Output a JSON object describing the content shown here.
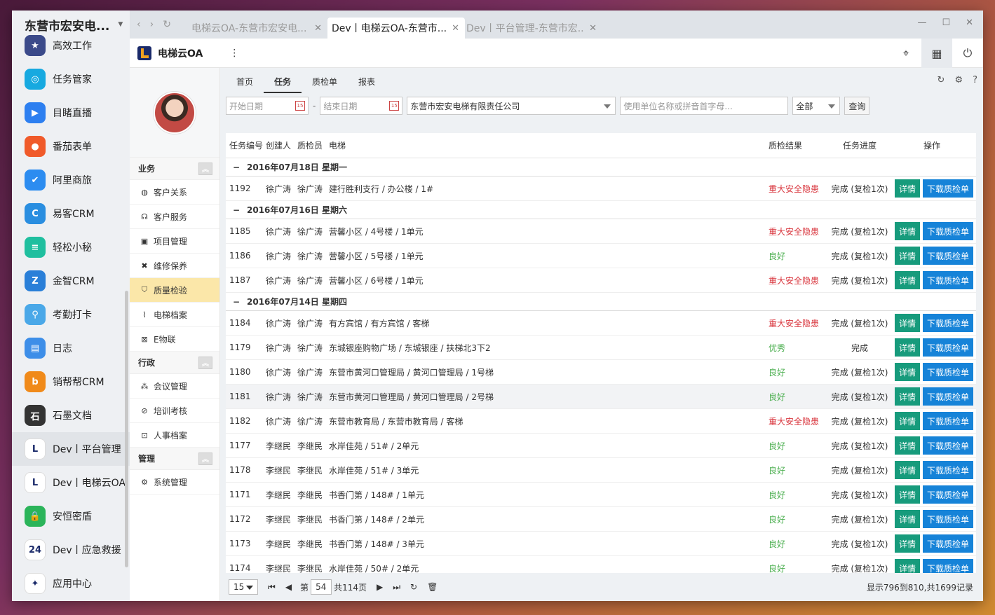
{
  "apps": {
    "title": "东营市宏安电...",
    "items": [
      {
        "label": "高效工作",
        "color": "#3b4a8a",
        "glyph": "★"
      },
      {
        "label": "任务管家",
        "color": "#17a9e0",
        "glyph": "◎"
      },
      {
        "label": "目睹直播",
        "color": "#2d7ff0",
        "glyph": "▶"
      },
      {
        "label": "番茄表单",
        "color": "#f05a2a",
        "glyph": "●"
      },
      {
        "label": "阿里商旅",
        "color": "#2c8cf0",
        "glyph": "✔"
      },
      {
        "label": "易客CRM",
        "color": "#2a8ee0",
        "glyph": "C"
      },
      {
        "label": "轻松小秘",
        "color": "#1fbf9f",
        "glyph": "≡"
      },
      {
        "label": "金智CRM",
        "color": "#2a7fd8",
        "glyph": "Z"
      },
      {
        "label": "考勤打卡",
        "color": "#4aa8e8",
        "glyph": "⚲"
      },
      {
        "label": "日志",
        "color": "#3d8ee8",
        "glyph": "▤"
      },
      {
        "label": "销帮帮CRM",
        "color": "#f08a1a",
        "glyph": "b"
      },
      {
        "label": "石墨文档",
        "color": "#333333",
        "glyph": "石"
      },
      {
        "label": "Dev丨平台管理",
        "color": "#ffffff",
        "glyph": "L"
      },
      {
        "label": "Dev丨电梯云OA",
        "color": "#ffffff",
        "glyph": "L"
      },
      {
        "label": "安恒密盾",
        "color": "#2bb45a",
        "glyph": "🔒"
      },
      {
        "label": "Dev丨应急救援",
        "color": "#ffffff",
        "glyph": "24"
      },
      {
        "label": "应用中心",
        "color": "#ffffff",
        "glyph": "✦"
      }
    ]
  },
  "browser_tabs": [
    {
      "label": "电梯云OA-东营市宏安电..."
    },
    {
      "label": "Dev丨电梯云OA-东营市..."
    },
    {
      "label": "Dev丨平台管理-东营市宏..."
    }
  ],
  "app": {
    "name": "电梯云OA"
  },
  "menu": {
    "groups": [
      {
        "title": "业务",
        "items": [
          {
            "label": "客户关系",
            "icon": "crm-icon",
            "glyph": "◍"
          },
          {
            "label": "客户服务",
            "icon": "headset-icon",
            "glyph": "☊"
          },
          {
            "label": "项目管理",
            "icon": "project-icon",
            "glyph": "▣"
          },
          {
            "label": "维修保养",
            "icon": "tools-icon",
            "glyph": "✖"
          },
          {
            "label": "质量检验",
            "icon": "shield-icon",
            "glyph": "⛉"
          },
          {
            "label": "电梯档案",
            "icon": "archive-icon",
            "glyph": "⌇"
          },
          {
            "label": "E物联",
            "icon": "iot-icon",
            "glyph": "⊠"
          }
        ]
      },
      {
        "title": "行政",
        "items": [
          {
            "label": "会议管理",
            "icon": "meeting-icon",
            "glyph": "⁂"
          },
          {
            "label": "培训考核",
            "icon": "training-icon",
            "glyph": "⊘"
          },
          {
            "label": "人事档案",
            "icon": "personnel-icon",
            "glyph": "⊡"
          }
        ]
      },
      {
        "title": "管理",
        "items": [
          {
            "label": "系统管理",
            "icon": "settings-icon",
            "glyph": "⚙"
          }
        ]
      }
    ]
  },
  "subtabs": [
    "首页",
    "任务",
    "质检单",
    "报表"
  ],
  "filters": {
    "start_ph": "开始日期",
    "end_ph": "结束日期",
    "company": "东营市宏安电梯有限责任公司",
    "unit_ph": "使用单位名称或拼音首字母...",
    "scope": "全部",
    "query": "查询"
  },
  "table": {
    "headers": {
      "id": "任务编号",
      "creator": "创建人",
      "inspector": "质检员",
      "elevator": "电梯",
      "result": "质检结果",
      "progress": "任务进度",
      "ops": "操作"
    },
    "detail_label": "详情",
    "download_label": "下载质检单",
    "groups": [
      {
        "date": "2016年07月18日 星期一",
        "rows": [
          {
            "id": "1192",
            "creator": "徐广涛",
            "inspector": "徐广涛",
            "elevator": "建行胜利支行 / 办公楼 / 1#",
            "result": "重大安全隐患",
            "status": "bad",
            "progress": "完成 (复检1次)"
          }
        ]
      },
      {
        "date": "2016年07月16日 星期六",
        "rows": [
          {
            "id": "1185",
            "creator": "徐广涛",
            "inspector": "徐广涛",
            "elevator": "营馨小区 / 4号楼 / 1单元",
            "result": "重大安全隐患",
            "status": "bad",
            "progress": "完成 (复检1次)"
          },
          {
            "id": "1186",
            "creator": "徐广涛",
            "inspector": "徐广涛",
            "elevator": "营馨小区 / 5号楼 / 1单元",
            "result": "良好",
            "status": "ok",
            "progress": "完成 (复检1次)"
          },
          {
            "id": "1187",
            "creator": "徐广涛",
            "inspector": "徐广涛",
            "elevator": "营馨小区 / 6号楼 / 1单元",
            "result": "重大安全隐患",
            "status": "bad",
            "progress": "完成 (复检1次)"
          }
        ]
      },
      {
        "date": "2016年07月14日 星期四",
        "rows": [
          {
            "id": "1184",
            "creator": "徐广涛",
            "inspector": "徐广涛",
            "elevator": "有方宾馆 / 有方宾馆 / 客梯",
            "result": "重大安全隐患",
            "status": "bad",
            "progress": "完成 (复检1次)"
          },
          {
            "id": "1179",
            "creator": "徐广涛",
            "inspector": "徐广涛",
            "elevator": "东城银座购物广场 / 东城银座 / 扶梯北3下2",
            "result": "优秀",
            "status": "ok",
            "progress": "完成"
          },
          {
            "id": "1180",
            "creator": "徐广涛",
            "inspector": "徐广涛",
            "elevator": "东营市黄河口管理局 / 黄河口管理局 / 1号梯",
            "result": "良好",
            "status": "ok",
            "progress": "完成 (复检1次)"
          },
          {
            "id": "1181",
            "creator": "徐广涛",
            "inspector": "徐广涛",
            "elevator": "东营市黄河口管理局 / 黄河口管理局 / 2号梯",
            "result": "良好",
            "status": "ok",
            "progress": "完成 (复检1次)",
            "hl": true
          },
          {
            "id": "1182",
            "creator": "徐广涛",
            "inspector": "徐广涛",
            "elevator": "东营市教育局 / 东营市教育局 / 客梯",
            "result": "重大安全隐患",
            "status": "bad",
            "progress": "完成 (复检1次)"
          },
          {
            "id": "1177",
            "creator": "李继民",
            "inspector": "李继民",
            "elevator": "水岸佳苑 / 51# / 2单元",
            "result": "良好",
            "status": "ok",
            "progress": "完成 (复检1次)"
          },
          {
            "id": "1178",
            "creator": "李继民",
            "inspector": "李继民",
            "elevator": "水岸佳苑 / 51# / 3单元",
            "result": "良好",
            "status": "ok",
            "progress": "完成 (复检1次)"
          },
          {
            "id": "1171",
            "creator": "李继民",
            "inspector": "李继民",
            "elevator": "书香门第 / 148# / 1单元",
            "result": "良好",
            "status": "ok",
            "progress": "完成 (复检1次)"
          },
          {
            "id": "1172",
            "creator": "李继民",
            "inspector": "李继民",
            "elevator": "书香门第 / 148# / 2单元",
            "result": "良好",
            "status": "ok",
            "progress": "完成 (复检1次)"
          },
          {
            "id": "1173",
            "creator": "李继民",
            "inspector": "李继民",
            "elevator": "书香门第 / 148# / 3单元",
            "result": "良好",
            "status": "ok",
            "progress": "完成 (复检1次)"
          },
          {
            "id": "1174",
            "creator": "李继民",
            "inspector": "李继民",
            "elevator": "水岸佳苑 / 50# / 2单元",
            "result": "良好",
            "status": "ok",
            "progress": "完成 (复检1次)"
          }
        ]
      }
    ]
  },
  "pager": {
    "page_size": "15",
    "page_prefix": "第",
    "page": "54",
    "total_pages": "共114页",
    "info": "显示796到810,共1699记录"
  },
  "colors": {
    "ok": "#4caf50",
    "bad": "#d9363e",
    "detail": "#179b7c",
    "download": "#1683d8",
    "active_menu": "#fbe7a9"
  }
}
